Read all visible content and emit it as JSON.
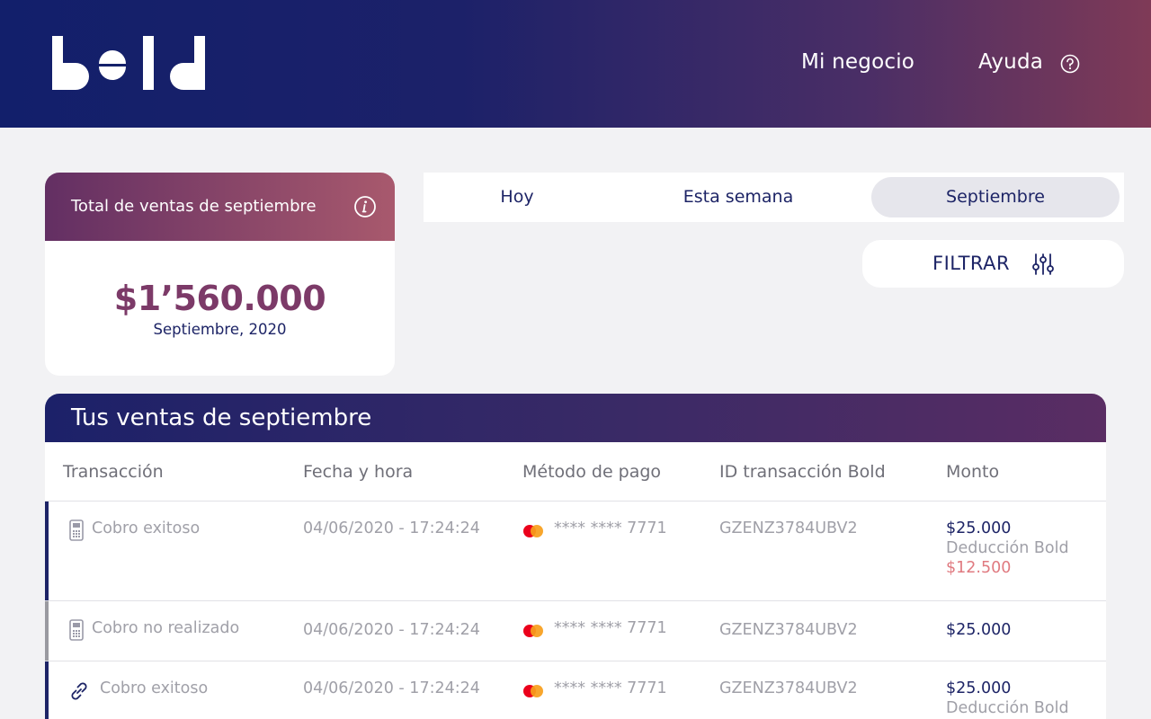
{
  "header": {
    "logo_text": "bold",
    "nav": [
      {
        "label": "Mi negocio"
      },
      {
        "label": "Ayuda"
      }
    ]
  },
  "summary": {
    "title": "Total de ventas de septiembre",
    "amount": "$1’560.000",
    "period": "Septiembre, 2020"
  },
  "tabs": [
    {
      "label": "Hoy",
      "selected": false
    },
    {
      "label": "Esta semana",
      "selected": false
    },
    {
      "label": "Septiembre",
      "selected": true
    }
  ],
  "filter": {
    "label": "FILTRAR"
  },
  "sales": {
    "title": "Tus ventas de septiembre",
    "columns": [
      "Transacción",
      "Fecha y hora",
      "Método de pago",
      "ID transacción Bold",
      "Monto"
    ],
    "rows": [
      {
        "status_icon": "card-reader-icon",
        "status": "Cobro exitoso",
        "datetime": "04/06/2020 - 17:24:24",
        "card": "**** **** 7771",
        "id": "GZENZ3784UBV2",
        "amount": "$25.000",
        "deduction_label": "Deducción Bold",
        "deduction_value": "$12.500",
        "accent": "#1d2466"
      },
      {
        "status_icon": "card-reader-icon",
        "status": "Cobro no realizado",
        "datetime": "04/06/2020 - 17:24:24",
        "card": "**** **** 7771",
        "id": "GZENZ3784UBV2",
        "amount": "$25.000",
        "accent": "#9a9aa0"
      },
      {
        "status_icon": "link-icon",
        "status": "Cobro exitoso",
        "datetime": "04/06/2020 - 17:24:24",
        "card": "**** **** 7771",
        "id": "GZENZ3784UBV2",
        "amount": "$25.000",
        "deduction_label": "Deducción Bold",
        "accent": "#1d2466"
      }
    ]
  },
  "colors": {
    "primary": "#1d2466",
    "brand_gradient_end": "#7f3a57",
    "amount_accent": "#7c3a68",
    "deduction_red": "#e07a80"
  }
}
